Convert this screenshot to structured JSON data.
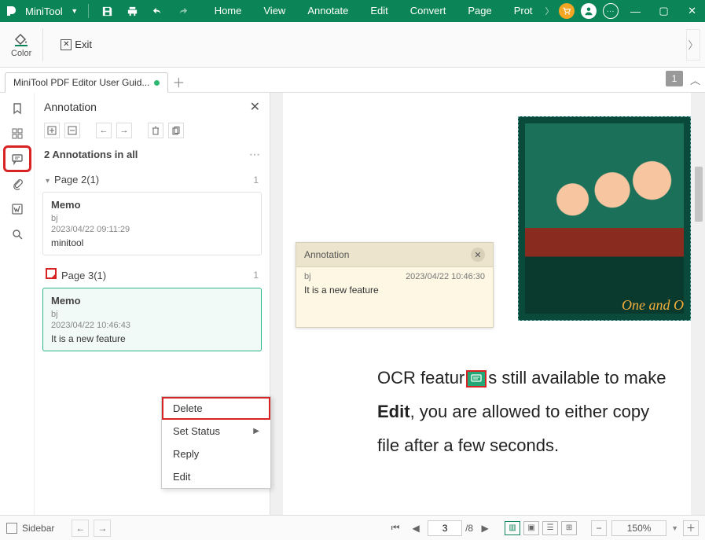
{
  "app": {
    "name": "MiniTool"
  },
  "menu": [
    "Home",
    "View",
    "Annotate",
    "Edit",
    "Convert",
    "Page",
    "Prot"
  ],
  "ribbon": {
    "color_label": "Color",
    "exit_label": "Exit"
  },
  "tab": {
    "filename": "MiniTool PDF Editor User Guid...",
    "page_badge": "1"
  },
  "sidepanel": {
    "title": "Annotation",
    "summary": "2 Annotations in all",
    "pages": [
      {
        "label": "Page 2(1)",
        "count": "1"
      },
      {
        "label": "Page 3(1)",
        "count": "1"
      }
    ],
    "annos": [
      {
        "title": "Memo",
        "author": "bj",
        "time": "2023/04/22 09:11:29",
        "body": "minitool"
      },
      {
        "title": "Memo",
        "author": "bj",
        "time": "2023/04/22 10:46:43",
        "body": "It is a new feature"
      }
    ]
  },
  "context_menu": {
    "items": [
      "Delete",
      "Set Status",
      "Reply",
      "Edit"
    ]
  },
  "popup": {
    "title": "Annotation",
    "author": "bj",
    "time": "2023/04/22 10:46:30",
    "body": "It is a new feature"
  },
  "doc": {
    "img_caption": "One and O",
    "line1_a": "OCR featur",
    "line1_b": "s still available to make",
    "line2_a": "Edit",
    "line2_b": ", you are allowed to either copy",
    "line3": "file after a few seconds."
  },
  "status": {
    "sidebar_label": "Sidebar",
    "current_page": "3",
    "total_pages": "/8",
    "zoom": "150%"
  }
}
